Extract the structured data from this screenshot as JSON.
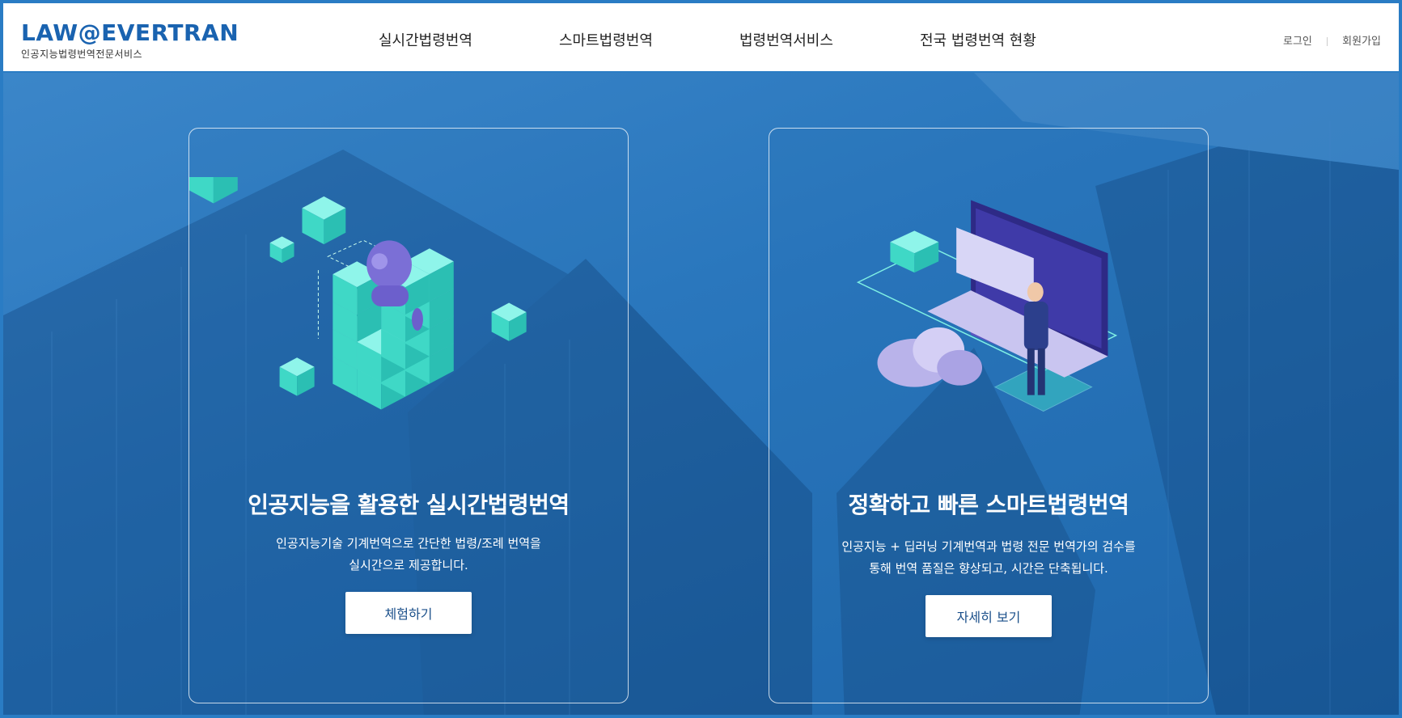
{
  "logo": {
    "main": "LAW@EVERTRAN",
    "sub": "인공지능법령번역전문서비스"
  },
  "nav": [
    {
      "label": "실시간법령번역"
    },
    {
      "label": "스마트법령번역"
    },
    {
      "label": "법령번역서비스"
    },
    {
      "label": "전국 법령번역 현황"
    }
  ],
  "util": {
    "login": "로그인",
    "signup": "회원가입"
  },
  "cards": [
    {
      "illustration": "ai-robot-cubes-illustration",
      "title": "인공지능을 활용한 실시간법령번역",
      "desc_line1": "인공지능기술 기계번역으로 간단한 법령/조례 번역을",
      "desc_line2": "실시간으로 제공합니다.",
      "button": "체험하기"
    },
    {
      "illustration": "laptop-cloud-businessman-illustration",
      "title": "정확하고 빠른 스마트법령번역",
      "desc_line1": "인공지능 + 딥러닝 기계번역과 법령 전문 번역가의 검수를",
      "desc_line2": "통해 번역 품질은 향상되고, 시간은 단축됩니다.",
      "button": "자세히 보기"
    }
  ],
  "colors": {
    "brand": "#1a63b0",
    "hero": "#2a77bd",
    "cube": "#4fe3d3"
  }
}
